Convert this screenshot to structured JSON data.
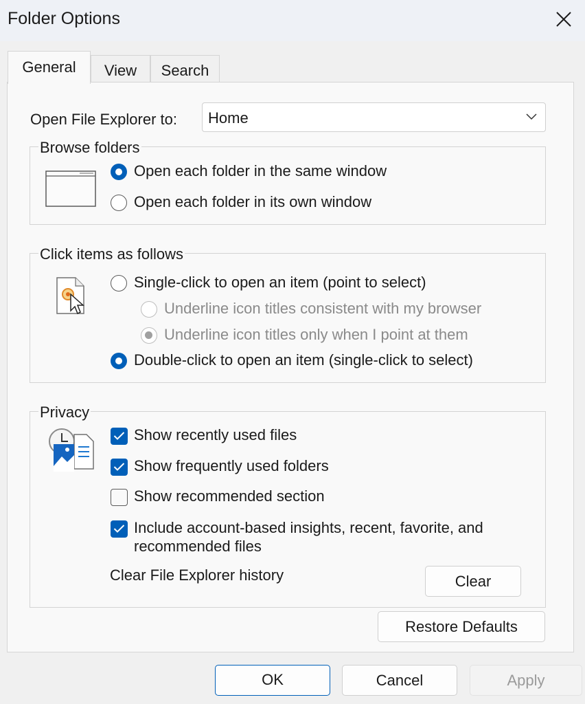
{
  "window": {
    "title": "Folder Options"
  },
  "tabs": [
    {
      "label": "General"
    },
    {
      "label": "View"
    },
    {
      "label": "Search"
    }
  ],
  "general": {
    "open_to_label": "Open File Explorer to:",
    "open_to_value": "Home",
    "browse": {
      "legend": "Browse folders",
      "options": [
        {
          "label": "Open each folder in the same window",
          "selected": true
        },
        {
          "label": "Open each folder in its own window",
          "selected": false
        }
      ]
    },
    "click": {
      "legend": "Click items as follows",
      "single": "Single-click to open an item (point to select)",
      "underline_browser": "Underline icon titles consistent with my browser",
      "underline_point": "Underline icon titles only when I point at them",
      "double": "Double-click to open an item (single-click to select)"
    },
    "privacy": {
      "legend": "Privacy",
      "items": [
        {
          "label": "Show recently used files",
          "checked": true
        },
        {
          "label": "Show frequently used folders",
          "checked": true
        },
        {
          "label": "Show recommended section",
          "checked": false
        },
        {
          "label": "Include account-based insights, recent, favorite, and",
          "label2": "recommended files",
          "checked": true
        }
      ],
      "clear_label": "Clear File Explorer history",
      "clear_button": "Clear"
    },
    "restore_button": "Restore Defaults"
  },
  "footer": {
    "ok": "OK",
    "cancel": "Cancel",
    "apply": "Apply"
  },
  "colors": {
    "accent": "#005fb8",
    "titlebar": "#eef1f6",
    "panel": "#f9f9f9"
  }
}
